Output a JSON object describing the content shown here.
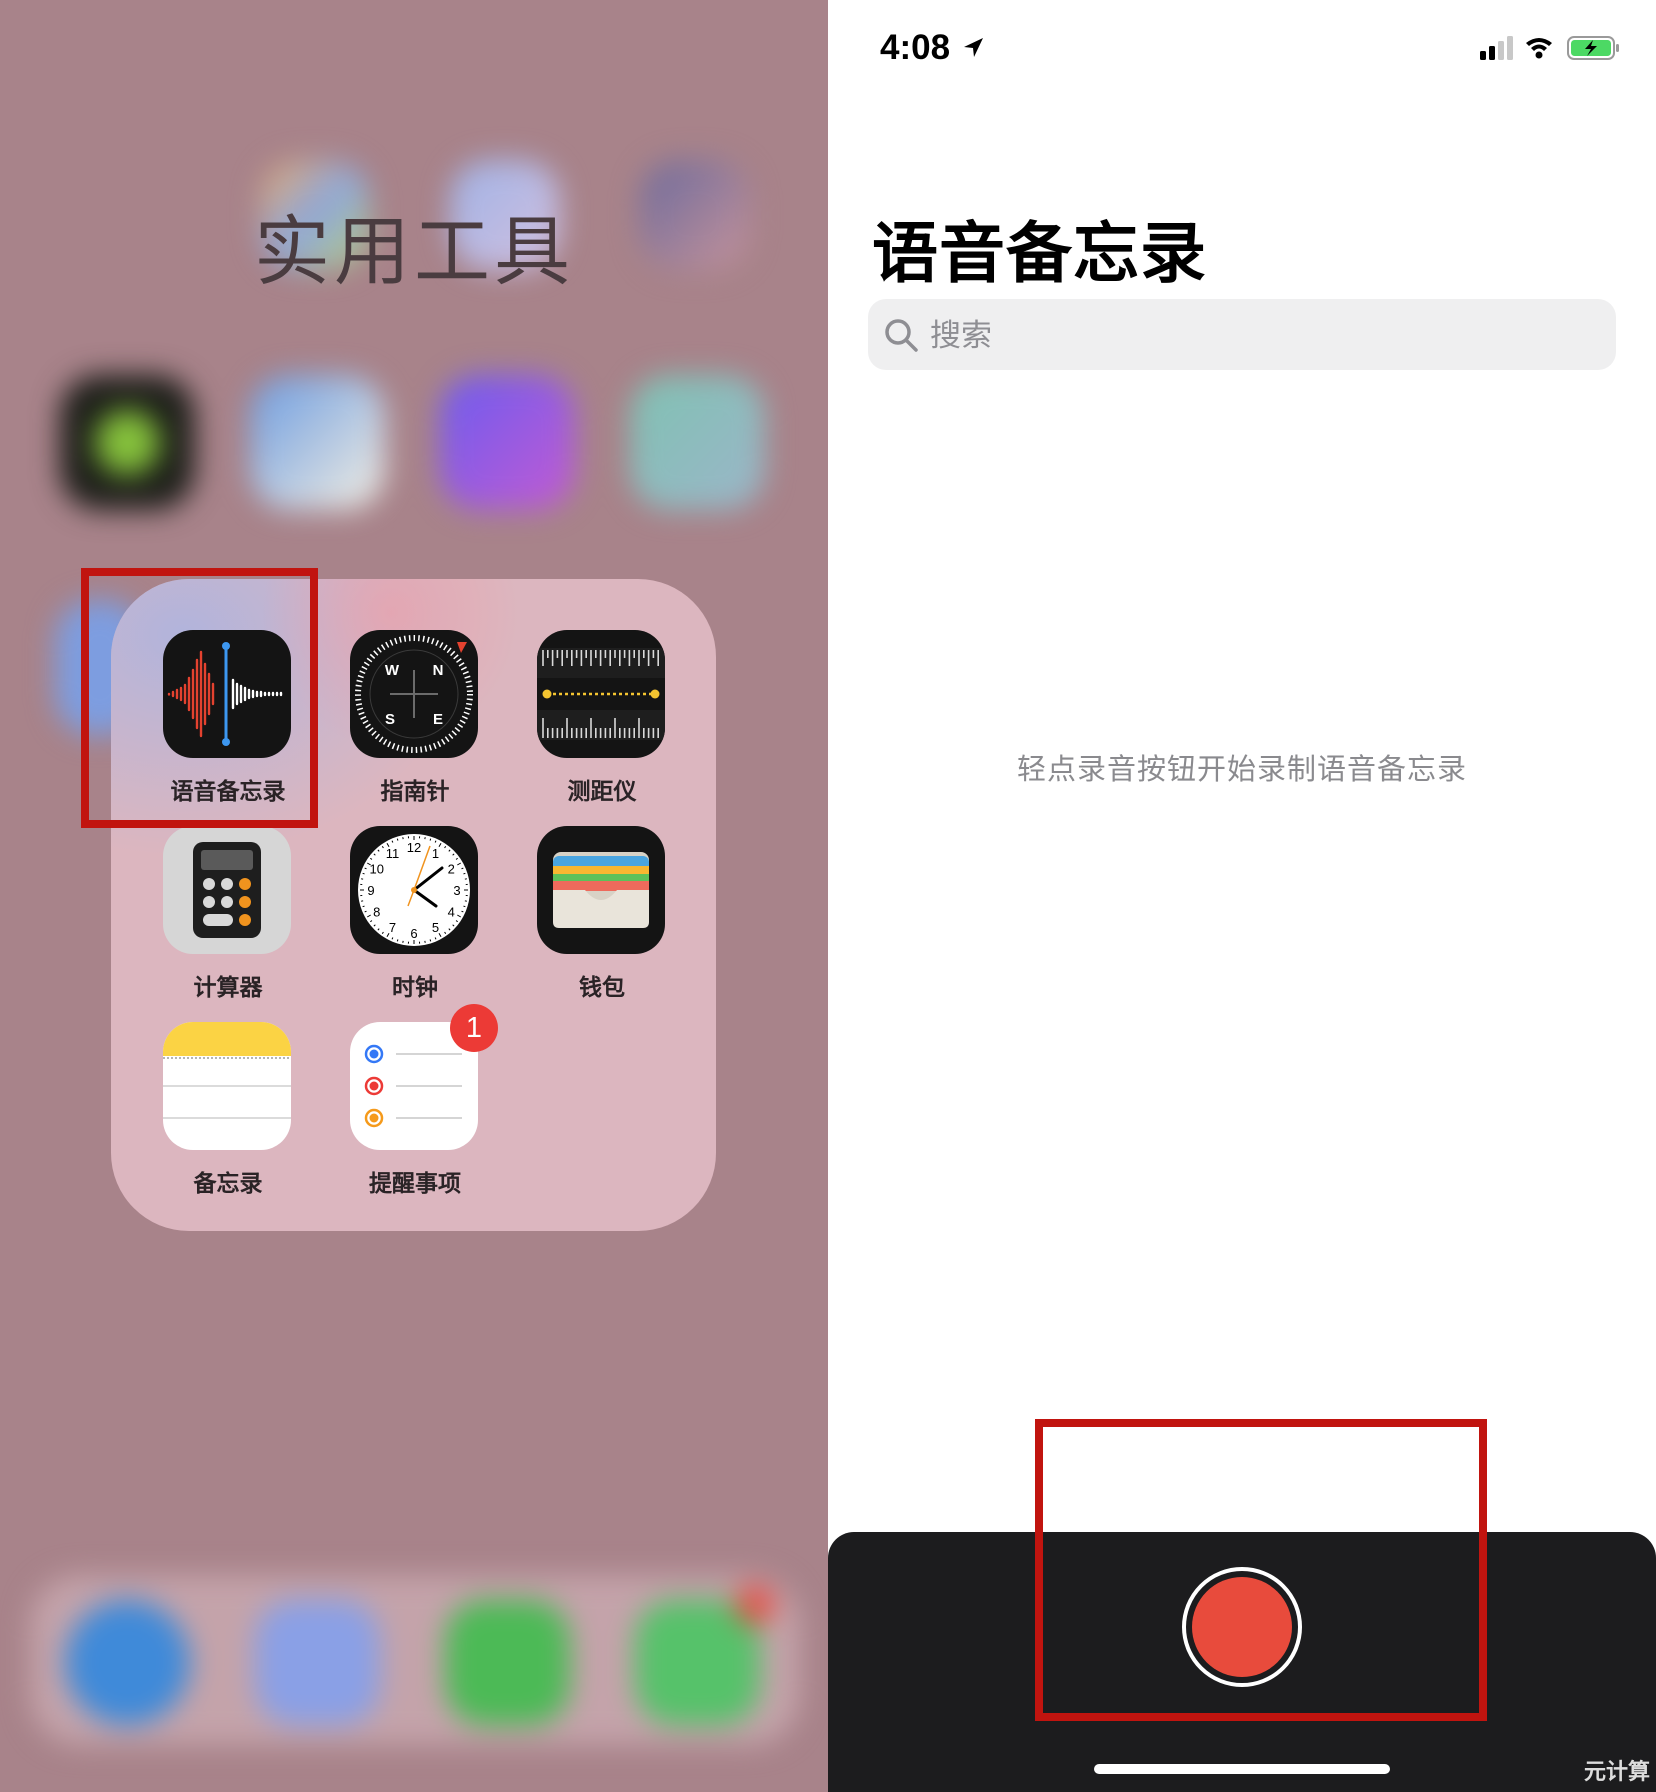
{
  "home": {
    "folder_title": "实用工具",
    "apps": [
      {
        "id": "voice-memos",
        "label": "语音备忘录"
      },
      {
        "id": "compass",
        "label": "指南针"
      },
      {
        "id": "measure",
        "label": "测距仪"
      },
      {
        "id": "calculator",
        "label": "计算器"
      },
      {
        "id": "clock",
        "label": "时钟"
      },
      {
        "id": "wallet",
        "label": "钱包"
      },
      {
        "id": "notes",
        "label": "备忘录"
      },
      {
        "id": "reminders",
        "label": "提醒事项",
        "badge": "1"
      }
    ],
    "compass_letters": {
      "n": "N",
      "s": "S",
      "e": "E",
      "w": "W"
    },
    "clock_numbers": [
      "12",
      "1",
      "2",
      "3",
      "4",
      "5",
      "6",
      "7",
      "8",
      "9",
      "10",
      "11"
    ]
  },
  "voice_memos": {
    "status_time": "4:08",
    "title": "语音备忘录",
    "search_placeholder": "搜索",
    "empty_hint": "轻点录音按钮开始录制语音备忘录"
  },
  "watermark": "元计算",
  "colors": {
    "highlight": "#c1140f",
    "record": "#e84b3c",
    "badge": "#ec3a36",
    "battery": "#4cd964"
  }
}
